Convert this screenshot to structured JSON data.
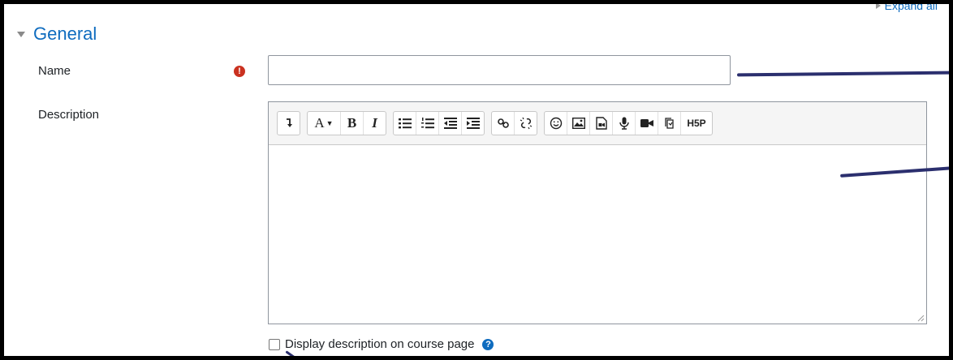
{
  "header": {
    "expand_all": "Expand all",
    "section_title": "General"
  },
  "form": {
    "name_label": "Name",
    "name_value": "",
    "description_label": "Description",
    "display_description_label": "Display description on course page",
    "required_icon": "!",
    "help_icon": "?"
  },
  "editor": {
    "toolbar": {
      "collapse": "collapse-icon",
      "font": "A",
      "bold": "B",
      "italic": "I",
      "h5p": "H5P"
    }
  },
  "colors": {
    "link_blue": "#0f6cbf",
    "required_red": "#ca3120",
    "annotation": "#2b2f6e"
  }
}
